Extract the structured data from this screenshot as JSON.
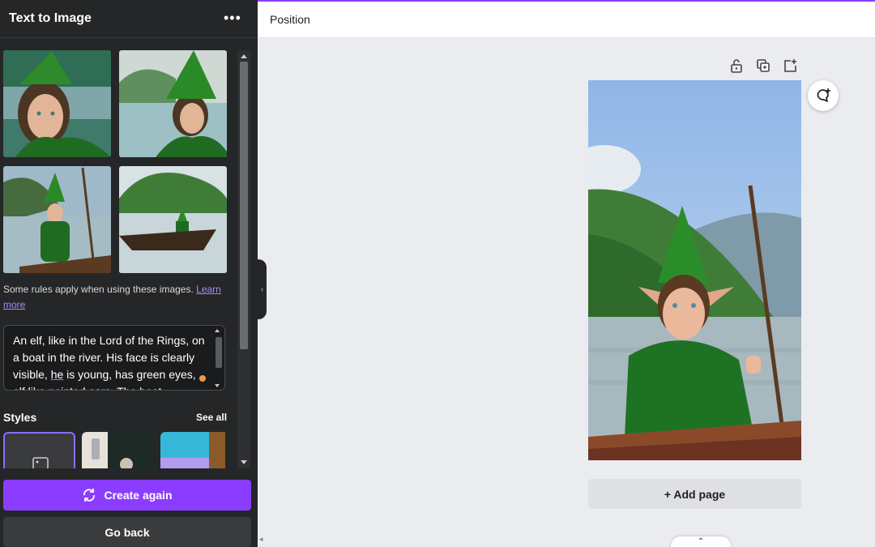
{
  "panel": {
    "title": "Text to Image",
    "more_icon": "more-horizontal-icon",
    "rules_text": "Some rules apply when using these images.",
    "rules_link": "Learn more",
    "prompt_parts": [
      "An elf, like in the Lord of the Rings, on a boat in the river. His face is clearly visible, ",
      "he",
      " is young, has green eyes, elf like pointed ears. The boat"
    ],
    "styles_label": "Styles",
    "see_all": "See all",
    "create_again": "Create again",
    "go_back": "Go back"
  },
  "topbar": {
    "position_label": "Position"
  },
  "canvas": {
    "add_page": "+ Add page",
    "tool_icons": [
      "unlock-icon",
      "duplicate-page-icon",
      "add-page-icon"
    ]
  },
  "colors": {
    "accent": "#8b3dff",
    "panel_bg": "#252627",
    "link": "#a58bff"
  }
}
